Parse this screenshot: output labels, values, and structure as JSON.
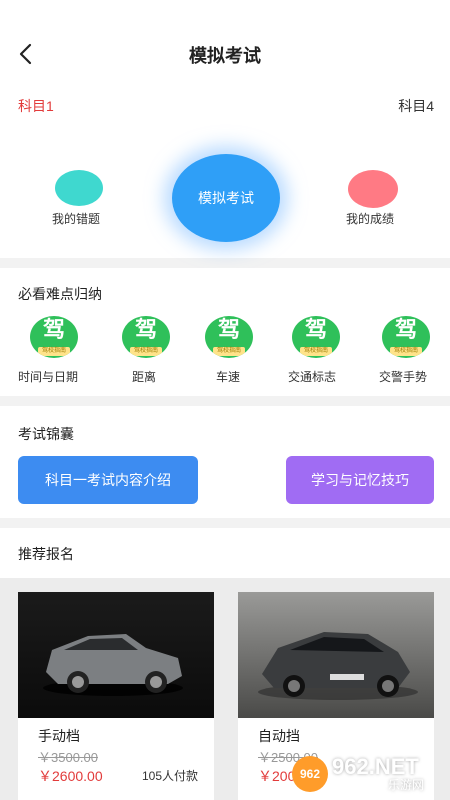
{
  "header": {
    "title": "模拟考试",
    "back_icon": "chevron-left-icon"
  },
  "exam": {
    "subject_left": "科目1",
    "subject_right": "科目4",
    "wrong_label": "我的错题",
    "mock_label": "模拟考试",
    "score_label": "我的成绩",
    "colors": {
      "teal": "#3fd8cf",
      "blue": "#2f9ff7",
      "red": "#ff7a84",
      "accent_red": "#e23b3b"
    }
  },
  "points": {
    "title": "必看难点归纳",
    "icon_glyph": "驾",
    "icon_tag": "驾校指南",
    "items": [
      {
        "label": "时间与日期"
      },
      {
        "label": "距离"
      },
      {
        "label": "车速"
      },
      {
        "label": "交通标志"
      },
      {
        "label": "交警手势"
      }
    ]
  },
  "tips": {
    "title": "考试锦囊",
    "button_left": "科目一考试内容介绍",
    "button_right": "学习与记忆技巧"
  },
  "recommend": {
    "title": "推荐报名",
    "cards": [
      {
        "name": "手动档",
        "old_price": "￥3500.00",
        "new_price": "￥2600.00",
        "payers": "105人付款"
      },
      {
        "name": "自动挡",
        "old_price": "￥2500.00",
        "new_price": "￥2000.00",
        "payers": ""
      }
    ]
  },
  "watermark": {
    "logo": "962",
    "text": "962.NET",
    "sub": "乐游网"
  }
}
